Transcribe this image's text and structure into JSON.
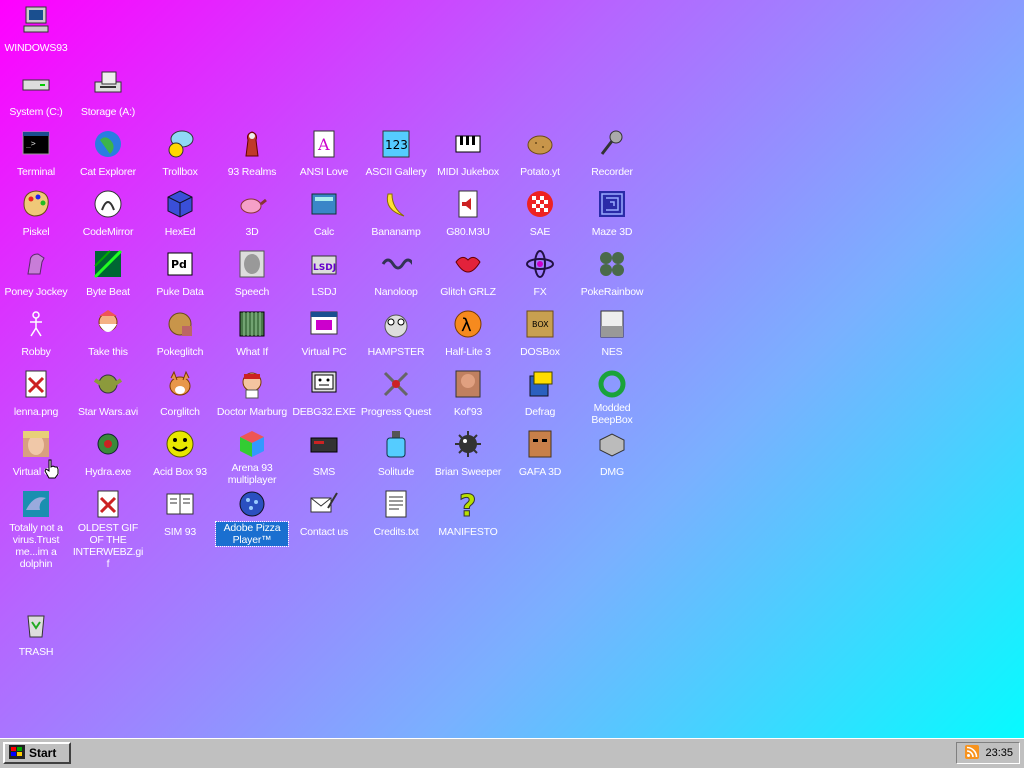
{
  "desktop": {
    "icons": [
      {
        "label": "WINDOWS93",
        "icon": "computer-icon"
      },
      {
        "label": "System (C:)",
        "icon": "drive-icon"
      },
      {
        "label": "Storage (A:)",
        "icon": "floppy-drive-icon"
      },
      {
        "label": "Terminal",
        "icon": "terminal-icon"
      },
      {
        "label": "Cat Explorer",
        "icon": "cat-globe-icon"
      },
      {
        "label": "Trollbox",
        "icon": "chat-bubble-icon"
      },
      {
        "label": "93 Realms",
        "icon": "knight-icon"
      },
      {
        "label": "ANSI Love",
        "icon": "ansi-letter-icon"
      },
      {
        "label": "ASCII Gallery",
        "icon": "numbers-icon"
      },
      {
        "label": "MIDI Jukebox",
        "icon": "piano-icon"
      },
      {
        "label": "Potato.yt",
        "icon": "potato-icon"
      },
      {
        "label": "Recorder",
        "icon": "microphone-icon"
      },
      {
        "label": "Piskel",
        "icon": "palette-icon"
      },
      {
        "label": "CodeMirror",
        "icon": "cat-mirror-icon"
      },
      {
        "label": "HexEd",
        "icon": "cube-icon"
      },
      {
        "label": "3D",
        "icon": "teapot-icon"
      },
      {
        "label": "Calc",
        "icon": "calculator-icon"
      },
      {
        "label": "Bananamp",
        "icon": "banana-icon"
      },
      {
        "label": "G80.M3U",
        "icon": "audio-file-icon"
      },
      {
        "label": "SAE",
        "icon": "checker-ball-icon"
      },
      {
        "label": "Maze 3D",
        "icon": "maze-icon"
      },
      {
        "label": "Poney Jockey",
        "icon": "pony-icon"
      },
      {
        "label": "Byte Beat",
        "icon": "byte-beat-icon"
      },
      {
        "label": "Puke Data",
        "icon": "pd-icon"
      },
      {
        "label": "Speech",
        "icon": "face-icon"
      },
      {
        "label": "LSDJ",
        "icon": "lsdj-icon"
      },
      {
        "label": "Nanoloop",
        "icon": "wave-icon"
      },
      {
        "label": "Glitch GRLZ",
        "icon": "lips-icon"
      },
      {
        "label": "FX",
        "icon": "atom-icon"
      },
      {
        "label": "PokeRainbow",
        "icon": "pokemon-icon"
      },
      {
        "label": "Robby",
        "icon": "stick-figure-icon"
      },
      {
        "label": "Take this",
        "icon": "dwarf-icon"
      },
      {
        "label": "Pokeglitch",
        "icon": "pokeglitch-icon"
      },
      {
        "label": "What If",
        "icon": "film-icon"
      },
      {
        "label": "Virtual PC",
        "icon": "window-icon"
      },
      {
        "label": "HAMPSTER",
        "icon": "owl-icon"
      },
      {
        "label": "Half-Lite 3",
        "icon": "lambda-icon"
      },
      {
        "label": "DOSBox",
        "icon": "dosbox-icon"
      },
      {
        "label": "NES",
        "icon": "nes-icon"
      },
      {
        "label": "lenna.png",
        "icon": "image-file-icon"
      },
      {
        "label": "Star Wars.avi",
        "icon": "yoda-icon"
      },
      {
        "label": "Corglitch",
        "icon": "corgi-icon"
      },
      {
        "label": "Doctor Marburg",
        "icon": "doctor-icon"
      },
      {
        "label": "DEBG32.EXE",
        "icon": "monitor-face-icon"
      },
      {
        "label": "Progress Quest",
        "icon": "swords-icon"
      },
      {
        "label": "Kof'93",
        "icon": "fighter-icon"
      },
      {
        "label": "Defrag",
        "icon": "defrag-icon"
      },
      {
        "label": "Modded BeepBox",
        "icon": "ring-icon"
      },
      {
        "label": "Virtual Girl",
        "icon": "girl-face-icon"
      },
      {
        "label": "Hydra.exe",
        "icon": "hydra-icon"
      },
      {
        "label": "Acid Box 93",
        "icon": "smiley-icon"
      },
      {
        "label": "Arena 93 multiplayer",
        "icon": "color-cube-icon"
      },
      {
        "label": "SMS",
        "icon": "console-icon"
      },
      {
        "label": "Solitude",
        "icon": "bottle-icon"
      },
      {
        "label": "Brian Sweeper",
        "icon": "mine-icon"
      },
      {
        "label": "GAFA 3D",
        "icon": "doom-face-icon"
      },
      {
        "label": "DMG",
        "icon": "drive-box-icon"
      },
      {
        "label": "Totally not a virus.Trust me...im a dolphin",
        "icon": "dolphin-icon"
      },
      {
        "label": "OLDEST GIF OF THE INTERWEBZ.gif",
        "icon": "gif-file-icon"
      },
      {
        "label": "SIM 93",
        "icon": "book-icon"
      },
      {
        "label": "Adobe Pizza Player™",
        "icon": "pizza-icon"
      },
      {
        "label": "Contact us",
        "icon": "letter-pen-icon"
      },
      {
        "label": "Credits.txt",
        "icon": "text-file-icon"
      },
      {
        "label": "MANIFESTO",
        "icon": "question-icon"
      },
      {
        "label": "TRASH",
        "icon": "recycle-bin-icon"
      }
    ]
  },
  "taskbar": {
    "start_label": "Start",
    "clock": "23:35"
  },
  "colors": {
    "selection": "#1a6fd0",
    "taskbar": "#c0c0c0"
  }
}
